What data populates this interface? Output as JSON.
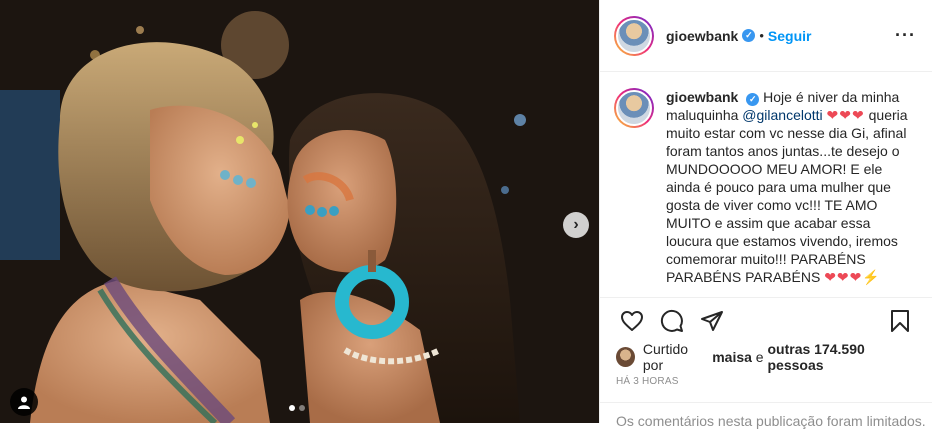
{
  "post": {
    "username": "gioewbank",
    "follow_label": "Seguir",
    "separator": "•",
    "more_icon": "more-horizontal-icon",
    "verified_icon": "verified-badge-icon"
  },
  "caption": {
    "username": "gioewbank",
    "text_1": "Hoje é niver da minha maluquinha ",
    "mention": "@gilancelotti",
    "hearts_1": "❤❤❤",
    "text_2": " queria muito estar com vc nesse dia Gi, afinal foram tantos anos juntas...te desejo o MUNDOOOOO MEU AMOR! E ele ainda é pouco para uma mulher que gosta de viver como vc!!! TE AMO MUITO e assim que acabar essa loucura que estamos vivendo, iremos comemorar muito!!! PARABÉNS PARABÉNS PARABÉNS ",
    "hearts_2": "❤❤❤",
    "bolt": "⚡"
  },
  "actions": {
    "like_icon": "heart-icon",
    "comment_icon": "comment-icon",
    "share_icon": "share-icon",
    "save_icon": "bookmark-icon"
  },
  "likes": {
    "prefix": "Curtido por ",
    "liker": "maisa",
    "middle": " e ",
    "others": "outras 174.590 pessoas"
  },
  "timestamp": "HÁ 3 HORAS",
  "comments_notice": "Os comentários nesta publicação foram limitados.",
  "media": {
    "next_icon": "chevron-right-icon",
    "tag_icon": "user-tag-icon",
    "carousel_count": 2,
    "carousel_active": 1
  }
}
